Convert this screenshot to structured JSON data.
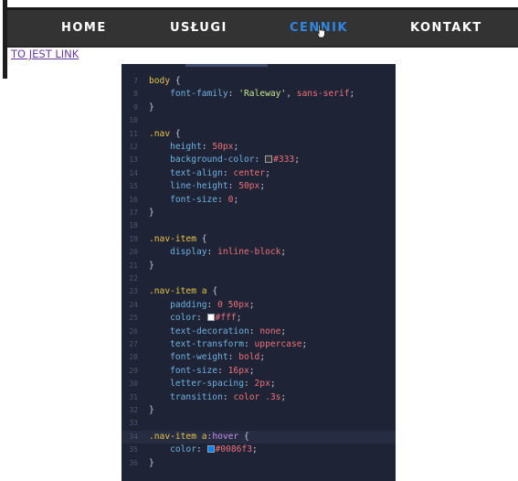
{
  "nav": {
    "items": [
      {
        "label": "HOME",
        "active": false
      },
      {
        "label": "USŁUGI",
        "active": false
      },
      {
        "label": "CENNIK",
        "active": true
      },
      {
        "label": "KONTAKT",
        "active": false
      }
    ],
    "background_color": "#333333",
    "active_color": "#2f86e3"
  },
  "page_link": {
    "text": "TO JEST LINK"
  },
  "editor": {
    "lines": [
      {
        "num": "7",
        "tokens": [
          {
            "t": "sel",
            "v": "body"
          },
          {
            "t": "punc",
            "v": " {"
          }
        ]
      },
      {
        "num": "8",
        "tokens": [
          {
            "t": "prop",
            "v": "    font-family"
          },
          {
            "t": "punc",
            "v": ": "
          },
          {
            "t": "str",
            "v": "'Raleway'"
          },
          {
            "t": "punc",
            "v": ", "
          },
          {
            "t": "val",
            "v": "sans-serif"
          },
          {
            "t": "punc",
            "v": ";"
          }
        ]
      },
      {
        "num": "9",
        "tokens": [
          {
            "t": "punc",
            "v": "}"
          }
        ]
      },
      {
        "num": "10",
        "tokens": []
      },
      {
        "num": "11",
        "tokens": [
          {
            "t": "sel",
            "v": ".nav"
          },
          {
            "t": "punc",
            "v": " {"
          }
        ]
      },
      {
        "num": "12",
        "tokens": [
          {
            "t": "prop",
            "v": "    height"
          },
          {
            "t": "punc",
            "v": ": "
          },
          {
            "t": "val",
            "v": "50px"
          },
          {
            "t": "punc",
            "v": ";"
          }
        ]
      },
      {
        "num": "13",
        "tokens": [
          {
            "t": "prop",
            "v": "    background-color"
          },
          {
            "t": "punc",
            "v": ": "
          },
          {
            "t": "swatch",
            "v": "#333333"
          },
          {
            "t": "val",
            "v": "#333"
          },
          {
            "t": "punc",
            "v": ";"
          }
        ]
      },
      {
        "num": "14",
        "tokens": [
          {
            "t": "prop",
            "v": "    text-align"
          },
          {
            "t": "punc",
            "v": ": "
          },
          {
            "t": "val",
            "v": "center"
          },
          {
            "t": "punc",
            "v": ";"
          }
        ]
      },
      {
        "num": "15",
        "tokens": [
          {
            "t": "prop",
            "v": "    line-height"
          },
          {
            "t": "punc",
            "v": ": "
          },
          {
            "t": "val",
            "v": "50px"
          },
          {
            "t": "punc",
            "v": ";"
          }
        ]
      },
      {
        "num": "16",
        "tokens": [
          {
            "t": "prop",
            "v": "    font-size"
          },
          {
            "t": "punc",
            "v": ": "
          },
          {
            "t": "val",
            "v": "0"
          },
          {
            "t": "punc",
            "v": ";"
          }
        ]
      },
      {
        "num": "17",
        "tokens": [
          {
            "t": "punc",
            "v": "}"
          }
        ]
      },
      {
        "num": "18",
        "tokens": []
      },
      {
        "num": "19",
        "tokens": [
          {
            "t": "sel",
            "v": ".nav-item"
          },
          {
            "t": "punc",
            "v": " {"
          }
        ]
      },
      {
        "num": "20",
        "tokens": [
          {
            "t": "prop",
            "v": "    display"
          },
          {
            "t": "punc",
            "v": ": "
          },
          {
            "t": "val",
            "v": "inline-block"
          },
          {
            "t": "punc",
            "v": ";"
          }
        ]
      },
      {
        "num": "21",
        "tokens": [
          {
            "t": "punc",
            "v": "}"
          }
        ]
      },
      {
        "num": "22",
        "tokens": []
      },
      {
        "num": "23",
        "tokens": [
          {
            "t": "sel",
            "v": ".nav-item a"
          },
          {
            "t": "punc",
            "v": " {"
          }
        ]
      },
      {
        "num": "24",
        "tokens": [
          {
            "t": "prop",
            "v": "    padding"
          },
          {
            "t": "punc",
            "v": ": "
          },
          {
            "t": "val",
            "v": "0 50px"
          },
          {
            "t": "punc",
            "v": ";"
          }
        ]
      },
      {
        "num": "25",
        "tokens": [
          {
            "t": "prop",
            "v": "    color"
          },
          {
            "t": "punc",
            "v": ": "
          },
          {
            "t": "swatch",
            "v": "#ffffff"
          },
          {
            "t": "val",
            "v": "#fff"
          },
          {
            "t": "punc",
            "v": ";"
          }
        ]
      },
      {
        "num": "26",
        "tokens": [
          {
            "t": "prop",
            "v": "    text-decoration"
          },
          {
            "t": "punc",
            "v": ": "
          },
          {
            "t": "val",
            "v": "none"
          },
          {
            "t": "punc",
            "v": ";"
          }
        ]
      },
      {
        "num": "27",
        "tokens": [
          {
            "t": "prop",
            "v": "    text-transform"
          },
          {
            "t": "punc",
            "v": ": "
          },
          {
            "t": "val",
            "v": "uppercase"
          },
          {
            "t": "punc",
            "v": ";"
          }
        ]
      },
      {
        "num": "28",
        "tokens": [
          {
            "t": "prop",
            "v": "    font-weight"
          },
          {
            "t": "punc",
            "v": ": "
          },
          {
            "t": "val",
            "v": "bold"
          },
          {
            "t": "punc",
            "v": ";"
          }
        ]
      },
      {
        "num": "29",
        "tokens": [
          {
            "t": "prop",
            "v": "    font-size"
          },
          {
            "t": "punc",
            "v": ": "
          },
          {
            "t": "val",
            "v": "16px"
          },
          {
            "t": "punc",
            "v": ";"
          }
        ]
      },
      {
        "num": "30",
        "tokens": [
          {
            "t": "prop",
            "v": "    letter-spacing"
          },
          {
            "t": "punc",
            "v": ": "
          },
          {
            "t": "val",
            "v": "2px"
          },
          {
            "t": "punc",
            "v": ";"
          }
        ]
      },
      {
        "num": "31",
        "tokens": [
          {
            "t": "prop",
            "v": "    transition"
          },
          {
            "t": "punc",
            "v": ": "
          },
          {
            "t": "val",
            "v": "color .3s"
          },
          {
            "t": "punc",
            "v": ";"
          }
        ]
      },
      {
        "num": "32",
        "tokens": [
          {
            "t": "punc",
            "v": "}"
          }
        ]
      },
      {
        "num": "33",
        "tokens": []
      },
      {
        "num": "34",
        "hl": true,
        "tokens": [
          {
            "t": "sel",
            "v": ".nav-item a"
          },
          {
            "t": "pseudo",
            "v": ":hover"
          },
          {
            "t": "punc",
            "v": " {"
          }
        ]
      },
      {
        "num": "35",
        "tokens": [
          {
            "t": "prop",
            "v": "    color"
          },
          {
            "t": "punc",
            "v": ": "
          },
          {
            "t": "swatch",
            "v": "#0086f3"
          },
          {
            "t": "val",
            "v": "#0086f3"
          },
          {
            "t": "punc",
            "v": ";"
          }
        ]
      },
      {
        "num": "36",
        "tokens": [
          {
            "t": "punc",
            "v": "}"
          }
        ]
      }
    ]
  }
}
